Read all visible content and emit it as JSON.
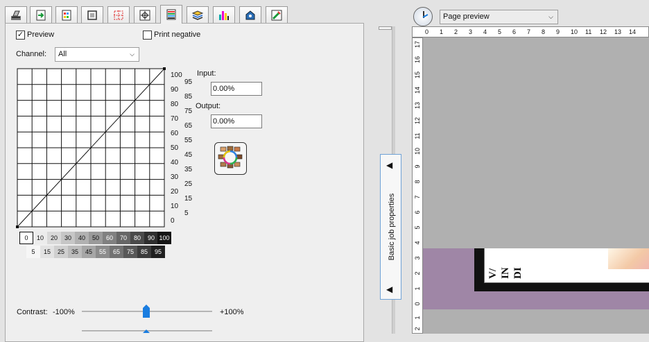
{
  "toolbar": {
    "tabs": [
      {
        "icon": "printer-settings-icon"
      },
      {
        "icon": "media-import-icon"
      },
      {
        "icon": "color-profile-icon"
      },
      {
        "icon": "crop-frame-icon"
      },
      {
        "icon": "cut-marks-icon"
      },
      {
        "icon": "registration-target-icon"
      },
      {
        "icon": "curve-adjust-icon"
      },
      {
        "icon": "layers-stack-icon"
      },
      {
        "icon": "ink-channels-icon"
      },
      {
        "icon": "spot-color-icon"
      },
      {
        "icon": "color-pick-icon"
      }
    ]
  },
  "options": {
    "preview_label": "Preview",
    "preview_mark": "✓",
    "print_negative_label": "Print negative"
  },
  "channel": {
    "label": "Channel:",
    "value": "All"
  },
  "curve": {
    "y_labels_main": [
      "100",
      "90",
      "80",
      "70",
      "60",
      "50",
      "40",
      "30",
      "20",
      "10",
      "0"
    ],
    "y_labels_half": [
      "95",
      "85",
      "75",
      "65",
      "55",
      "45",
      "35",
      "25",
      "15",
      "5"
    ],
    "gray_top": [
      "0",
      "10",
      "20",
      "30",
      "40",
      "50",
      "60",
      "70",
      "80",
      "90",
      "100"
    ],
    "gray_bottom": [
      "5",
      "15",
      "25",
      "35",
      "45",
      "55",
      "65",
      "75",
      "85",
      "95"
    ]
  },
  "input": {
    "label": "Input:",
    "value": "0.00%"
  },
  "output": {
    "label": "Output:",
    "value": "0.00%"
  },
  "contrast": {
    "label": "Contrast:",
    "min": "-100%",
    "max": "+100%",
    "value_pct": 50
  },
  "side_panel": {
    "label": "Basic job properties"
  },
  "preview": {
    "mode": "Page preview",
    "h_ruler": [
      "0",
      "1",
      "2",
      "3",
      "4",
      "5",
      "6",
      "7",
      "8",
      "9",
      "10",
      "11",
      "12",
      "13",
      "14"
    ],
    "v_ruler": [
      "17",
      "16",
      "15",
      "14",
      "13",
      "12",
      "11",
      "10",
      "9",
      "8",
      "7",
      "6",
      "5",
      "4",
      "3",
      "2",
      "1",
      "0",
      "1",
      "2"
    ],
    "doc_text": [
      "V/",
      "IN",
      "DI"
    ]
  }
}
